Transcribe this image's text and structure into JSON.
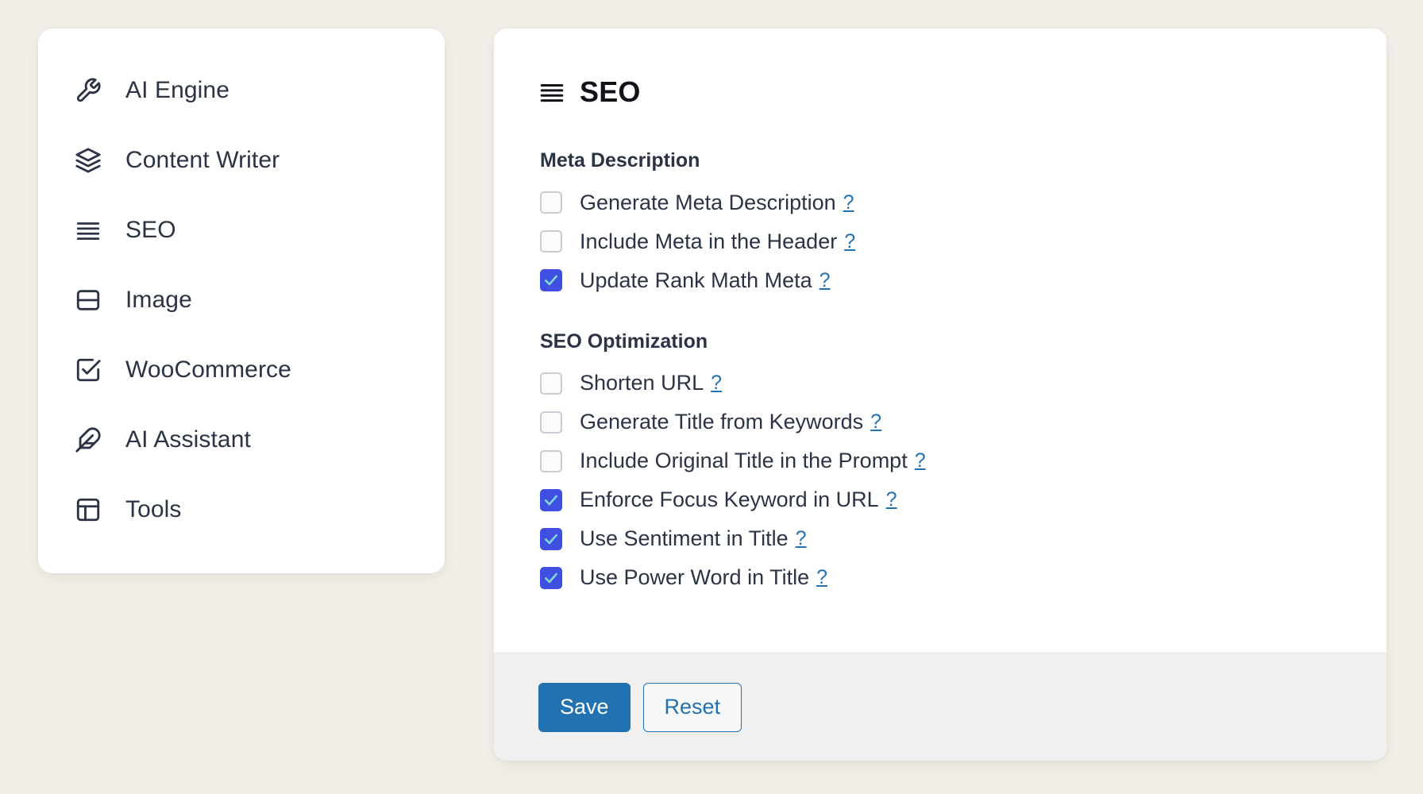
{
  "theme": {
    "page_background": "#f2efe9",
    "card_background": "#ffffff",
    "text_color": "#2b3344",
    "link_color": "#2271b1",
    "checkbox_checked_color": "#3f4fe0",
    "primary_button_color": "#2271b1",
    "footer_background": "#f0f0f0"
  },
  "sidebar": {
    "items": [
      {
        "label": "AI Engine",
        "icon": "wrench-icon"
      },
      {
        "label": "Content Writer",
        "icon": "layers-icon"
      },
      {
        "label": "SEO",
        "icon": "menu-lines-icon"
      },
      {
        "label": "Image",
        "icon": "image-panel-icon"
      },
      {
        "label": "WooCommerce",
        "icon": "check-square-icon"
      },
      {
        "label": "AI Assistant",
        "icon": "feather-icon"
      },
      {
        "label": "Tools",
        "icon": "layout-icon"
      }
    ]
  },
  "panel": {
    "title": "SEO",
    "title_icon": "menu-lines-icon",
    "help_symbol": "?",
    "sections": [
      {
        "title": "Meta Description",
        "options": [
          {
            "label": "Generate Meta Description",
            "checked": false
          },
          {
            "label": "Include Meta in the Header",
            "checked": false
          },
          {
            "label": "Update Rank Math Meta",
            "checked": true
          }
        ]
      },
      {
        "title": "SEO Optimization",
        "options": [
          {
            "label": "Shorten URL",
            "checked": false
          },
          {
            "label": "Generate Title from Keywords",
            "checked": false
          },
          {
            "label": "Include Original Title in the Prompt",
            "checked": false
          },
          {
            "label": "Enforce Focus Keyword in URL",
            "checked": true
          },
          {
            "label": "Use Sentiment in Title",
            "checked": true
          },
          {
            "label": "Use Power Word in Title",
            "checked": true
          }
        ]
      }
    ],
    "footer": {
      "save_label": "Save",
      "reset_label": "Reset"
    }
  }
}
